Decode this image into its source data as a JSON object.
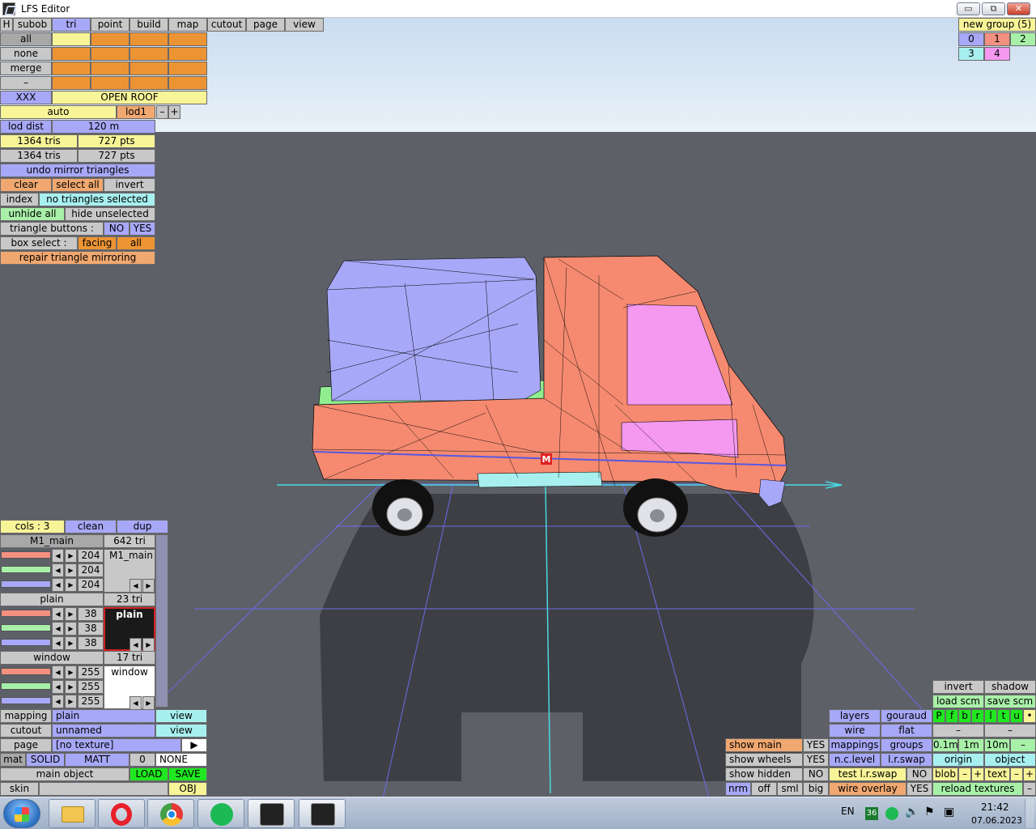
{
  "window": {
    "title": "LFS Editor",
    "min": "▭",
    "max": "⧉",
    "close": "✕"
  },
  "menu": {
    "h": "H",
    "items": [
      "subob",
      "tri",
      "point",
      "build",
      "map",
      "cutout",
      "page",
      "view"
    ]
  },
  "left": {
    "all": "all",
    "none": "none",
    "merge": "merge",
    "dash": "–",
    "xxx": "XXX",
    "open_roof": "OPEN ROOF",
    "auto": "auto",
    "lod1": "lod1",
    "minus": "–",
    "plus": "+",
    "lod_dist": "lod dist",
    "lod_val": "120 m",
    "tris1": "1364 tris",
    "pts1": "727 pts",
    "tris2": "1364 tris",
    "pts2": "727 pts",
    "undo": "undo mirror triangles",
    "clear": "clear",
    "select_all": "select all",
    "invert": "invert",
    "index": "index",
    "no_sel": "no triangles selected",
    "unhide": "unhide all",
    "hide_unsel": "hide unselected",
    "tri_buttons": "triangle buttons :",
    "no": "NO",
    "yes": "YES",
    "box_select": "box select :",
    "facing": "facing",
    "bs_all": "all",
    "repair": "repair triangle mirroring"
  },
  "groups": {
    "new_group": "new group (5)",
    "g0": "0",
    "g1": "1",
    "g2": "2",
    "g3": "3",
    "g4": "4"
  },
  "materials": {
    "cols": "cols : 3",
    "clean": "clean",
    "dup": "dup",
    "m1_name": "M1_main",
    "m1_tri": "642 tri",
    "m1_label": "M1_main",
    "m1_vals": [
      "204",
      "204",
      "204"
    ],
    "m2_name": "plain",
    "m2_tri": "23 tri",
    "m2_label": "plain",
    "m2_vals": [
      "38",
      "38",
      "38"
    ],
    "m3_name": "window",
    "m3_tri": "17 tri",
    "m3_label": "window",
    "m3_vals": [
      "255",
      "255",
      "255"
    ]
  },
  "bottom_left": {
    "mapping": "mapping",
    "mapping_val": "plain",
    "view": "view",
    "cutout": "cutout",
    "cutout_val": "unnamed",
    "view2": "view",
    "page": "page",
    "page_val": "[no texture]",
    "page_arrow": "▶",
    "mat": "mat",
    "solid": "SOLID",
    "matt": "MATT",
    "zero": "0",
    "none": "NONE",
    "main_object": "main object",
    "load": "LOAD",
    "save": "SAVE",
    "skin": "skin",
    "obj": "OBJ"
  },
  "bottom_right": {
    "invert": "invert",
    "shadow": "shadow",
    "load_scm": "load scm",
    "save_scm": "save scm",
    "layers": "layers",
    "gouraud": "gouraud",
    "flags": [
      "P",
      "f",
      "b",
      "r",
      "l",
      "t",
      "u",
      "•"
    ],
    "wire": "wire",
    "flat": "flat",
    "dash1": "–",
    "dash2": "–",
    "show_main": "show main",
    "show_main_v": "YES",
    "mappings": "mappings",
    "groups": "groups",
    "s01": "0.1m",
    "s1": "1m",
    "s10": "10m",
    "sdash": "–",
    "show_wheels": "show wheels",
    "show_wheels_v": "YES",
    "nclevel": "n.c.level",
    "lrswap": "l.r.swap",
    "origin": "origin",
    "object": "object",
    "show_hidden": "show hidden",
    "show_hidden_v": "NO",
    "test_lr": "test l.r.swap",
    "test_lr_v": "NO",
    "blob": "blob",
    "bminus": "–",
    "bplus": "+",
    "text": "text",
    "tminus": "–",
    "tplus": "+",
    "nrm": "nrm",
    "off": "off",
    "sml": "sml",
    "big": "big",
    "wire_overlay": "wire overlay",
    "wire_overlay_v": "YES",
    "reload": "reload textures",
    "rdash": "–"
  },
  "scene": {
    "marker": "M"
  },
  "taskbar": {
    "lang": "EN",
    "badge": "36",
    "time": "21:42",
    "date": "07.06.2023"
  }
}
